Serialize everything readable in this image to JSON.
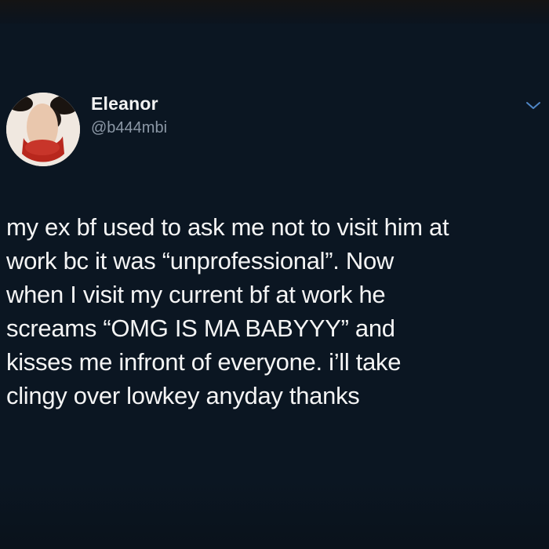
{
  "tweet": {
    "author": {
      "display_name": "Eleanor",
      "handle": "@b444mbi",
      "avatar_icon": "user-avatar"
    },
    "menu_icon": "chevron-down-icon",
    "lines": [
      "my ex bf used to ask me not to visit him at",
      "work bc it was “unprofessional”. Now",
      "when I visit my current bf at work he",
      "screams “OMG IS MA BABYYY” and",
      "kisses me infront of everyone. i’ll take",
      "clingy over lowkey anyday thanks"
    ]
  },
  "colors": {
    "background": "#0b1622",
    "text": "#f4f4f4",
    "handle": "#8c98a6",
    "chevron": "#4f86c6"
  }
}
